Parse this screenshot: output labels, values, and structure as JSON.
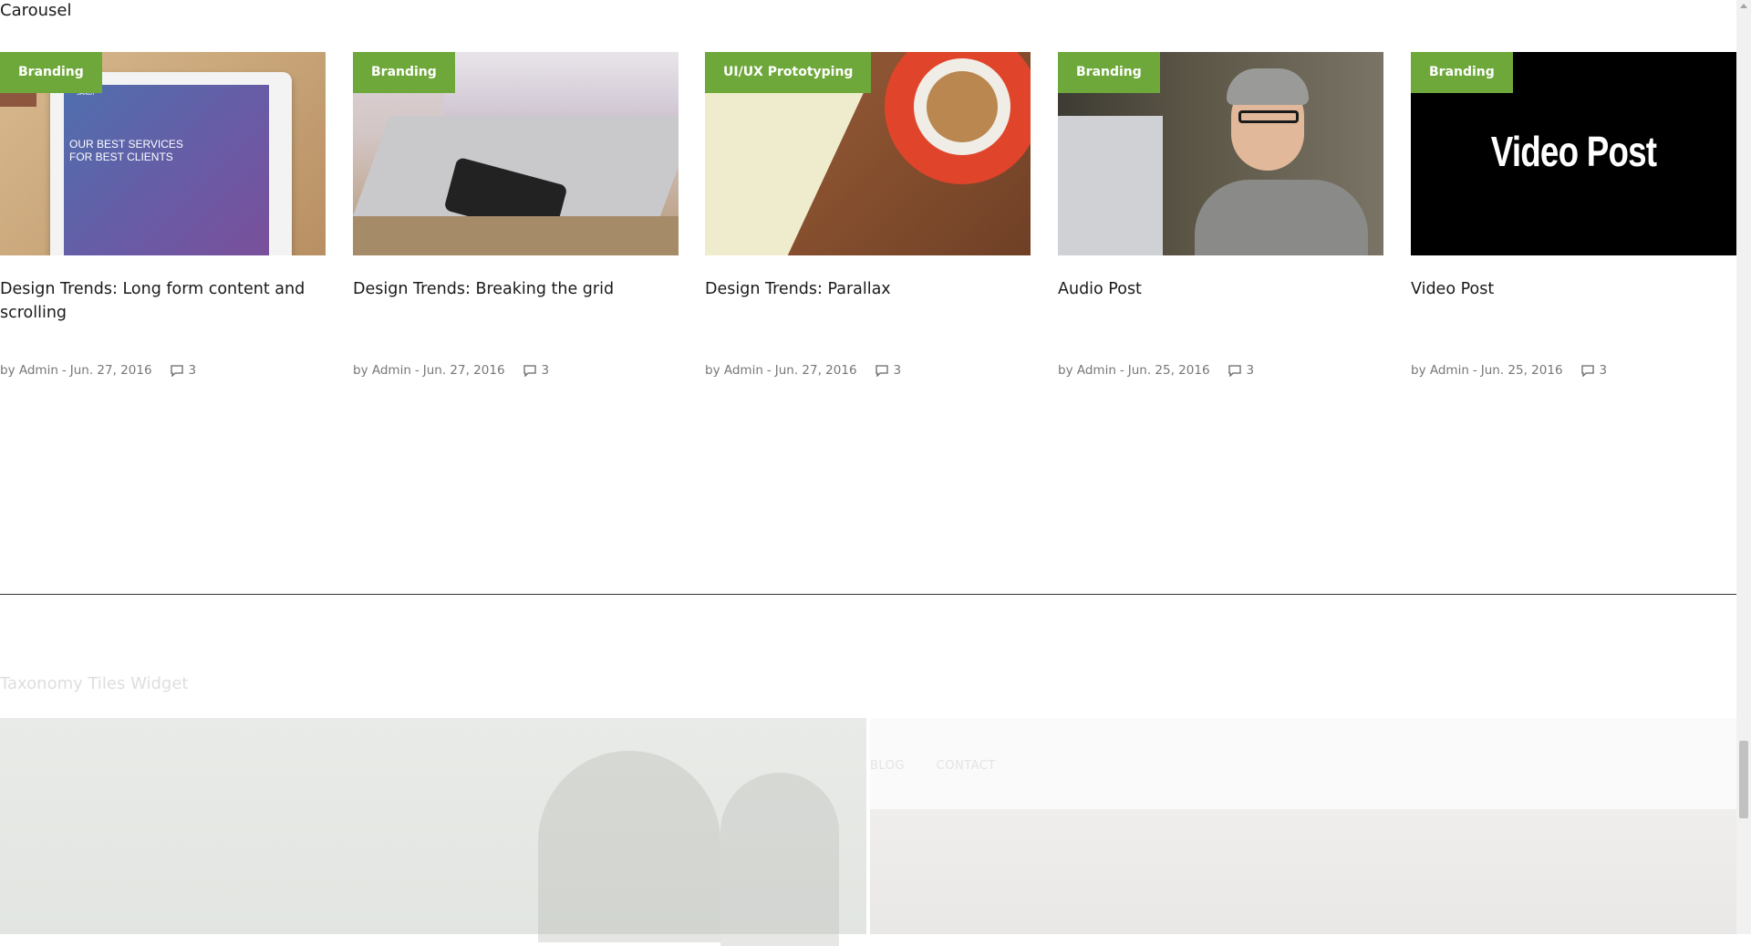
{
  "carousel": {
    "title": "Carousel",
    "cards": [
      {
        "category": "Branding",
        "title": "Design Trends: Long form content and scrolling",
        "meta_by": "by Admin",
        "date": "Jun. 27, 2016",
        "comments": "3",
        "image": "tablet-mockup"
      },
      {
        "category": "Branding",
        "title": "Design Trends: Breaking the grid",
        "meta_by": "by Admin",
        "date": "Jun. 27, 2016",
        "comments": "3",
        "image": "laptop-phone"
      },
      {
        "category": "UI/UX Prototyping",
        "title": "Design Trends: Parallax",
        "meta_by": "by Admin",
        "date": "Jun. 27, 2016",
        "comments": "3",
        "image": "coffee-keyboard"
      },
      {
        "category": "Branding",
        "title": "Audio Post",
        "meta_by": "by Admin",
        "date": "Jun. 25, 2016",
        "comments": "3",
        "image": "man-laptop"
      },
      {
        "category": "Branding",
        "title": "Video Post",
        "meta_by": "by Admin",
        "date": "Jun. 25, 2016",
        "comments": "3",
        "image": "video-post-black",
        "image_text": "Video Post"
      }
    ],
    "tablet_mock_line1": "OUR BEST SERVICES",
    "tablet_mock_line2": "FOR BEST CLIENTS",
    "tablet_mock_brand": "SANDY"
  },
  "taxonomy": {
    "title": "Taxonomy Tiles Widget",
    "nav_items": [
      "BLOG",
      "CONTACT"
    ]
  },
  "colors": {
    "accent": "#6ea83a"
  }
}
